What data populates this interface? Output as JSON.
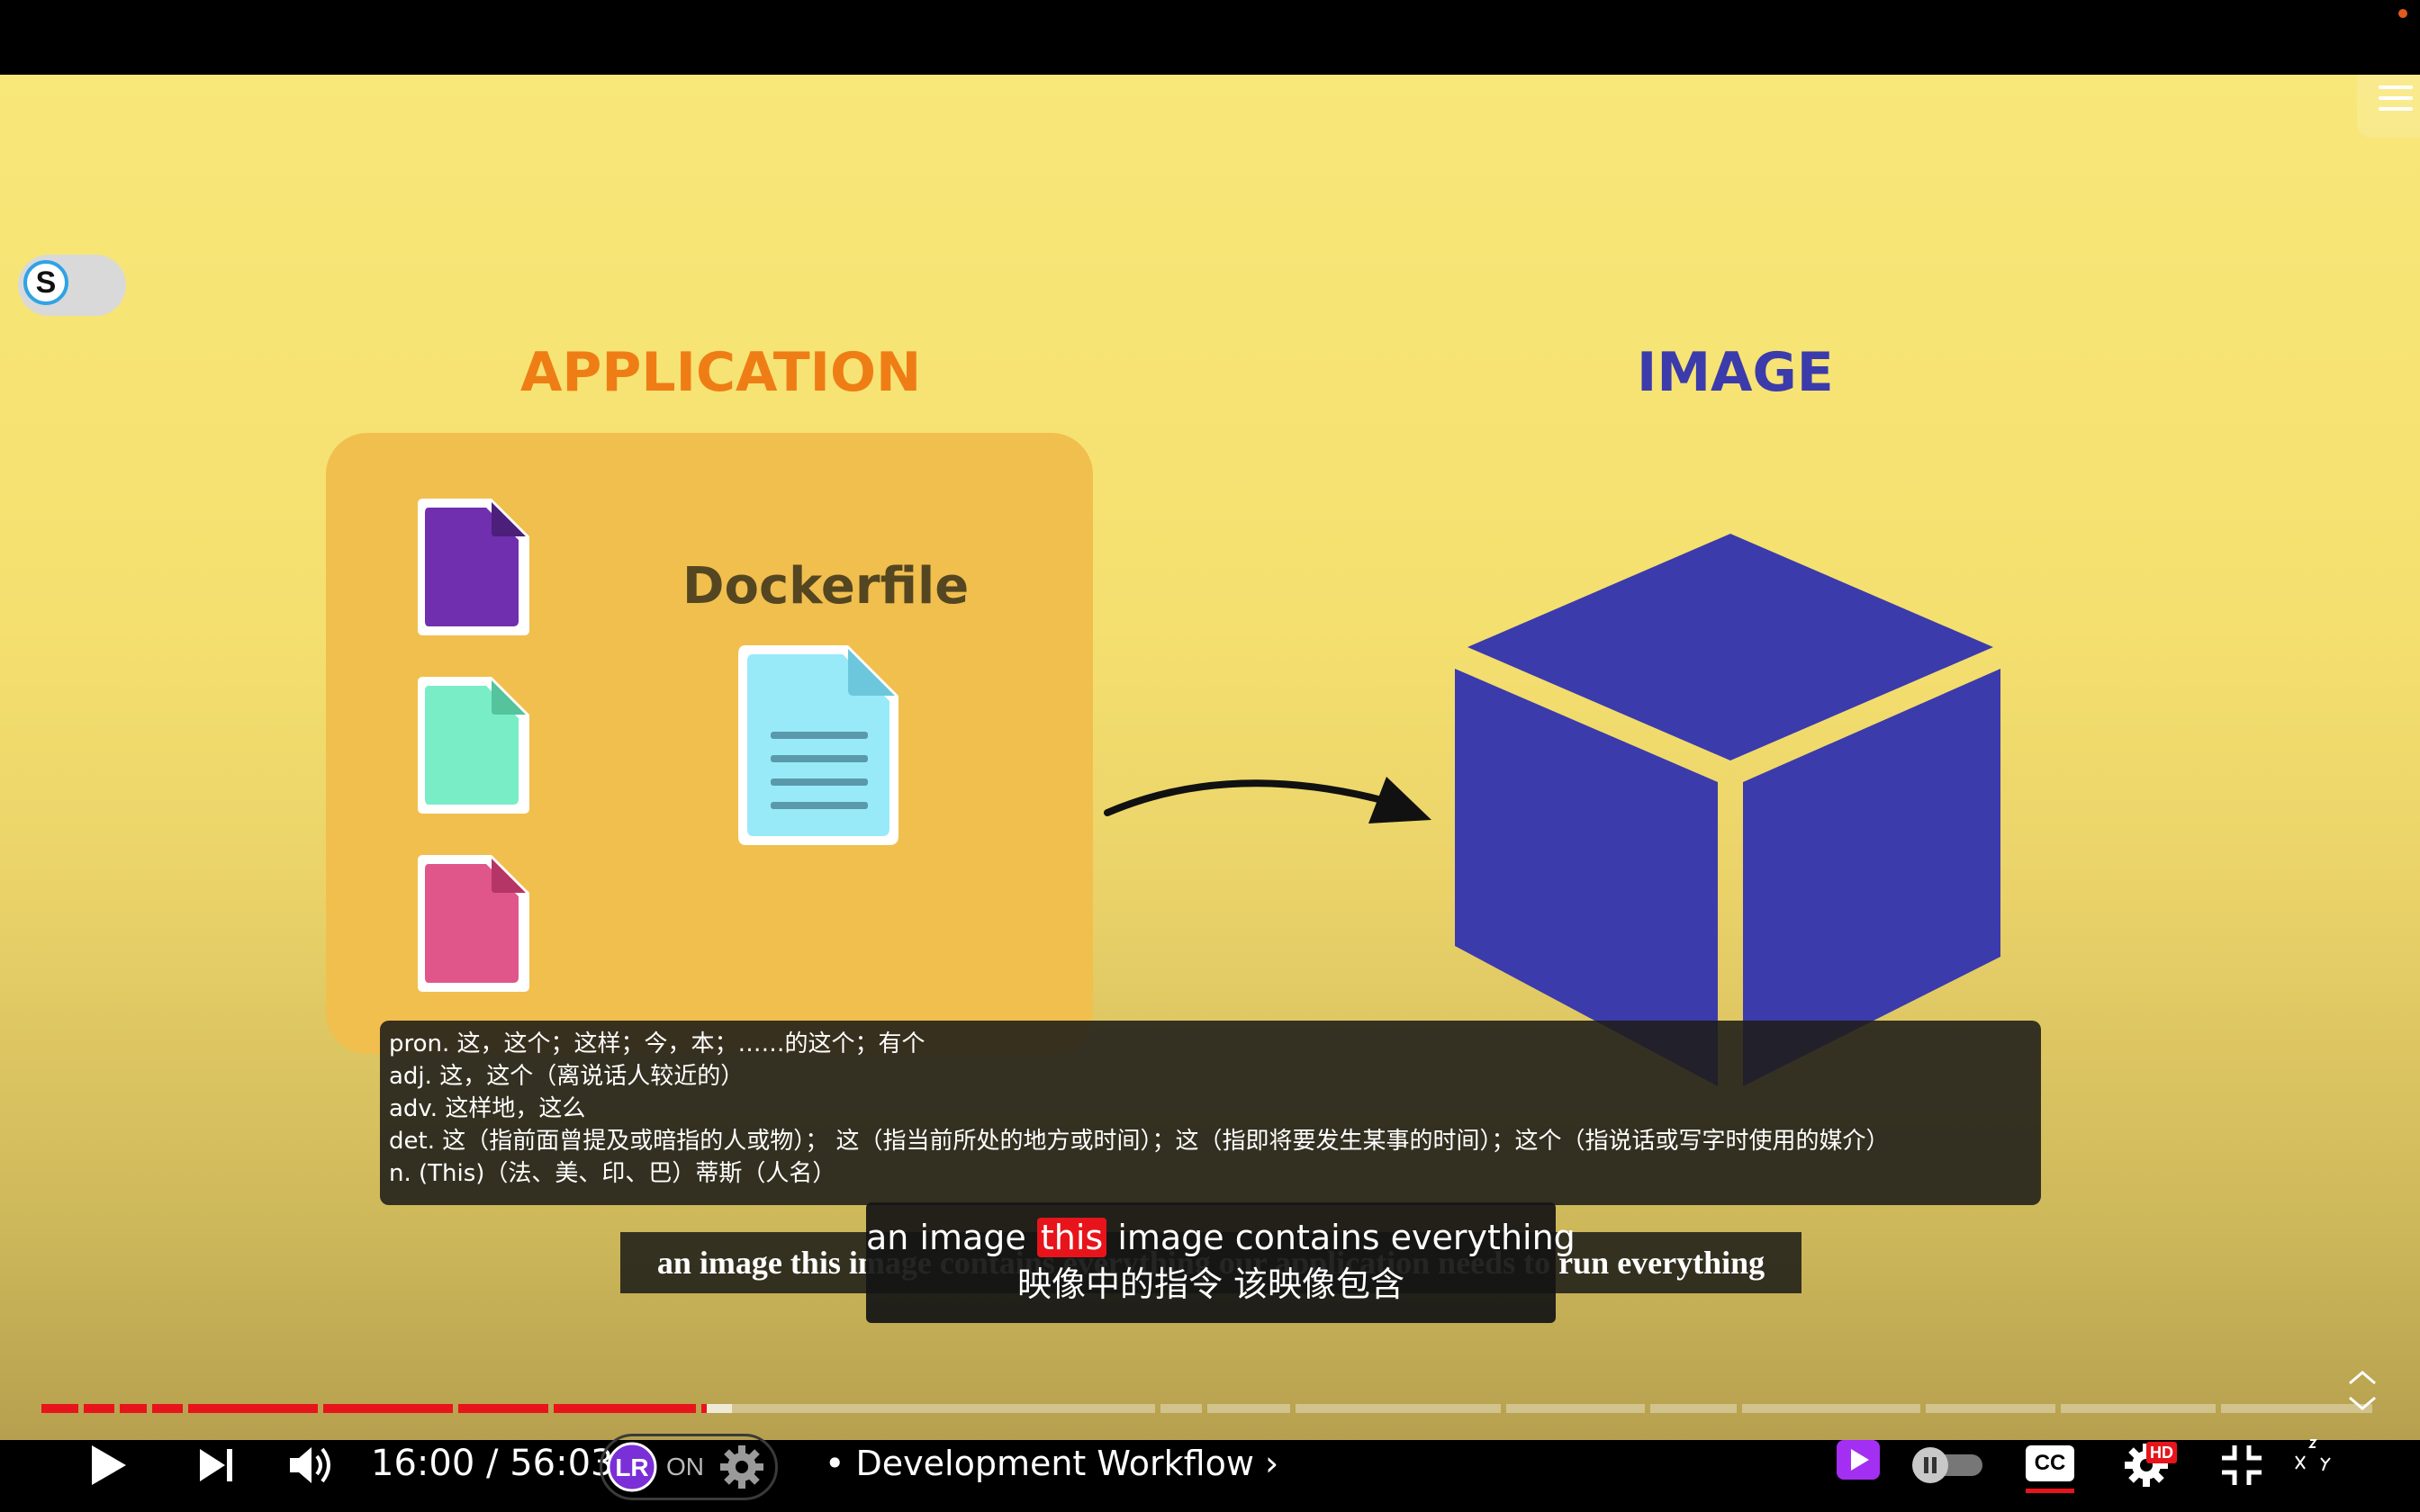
{
  "video": {
    "app_heading": "APPLICATION",
    "image_heading": "IMAGE",
    "dockerfile_label": "Dockerfile",
    "colors": {
      "app_heading": "#ef7d16",
      "image_heading": "#3c3bab",
      "cube": "#3c3bab",
      "app_box": "#f1bf4e",
      "file_purple": "#6f2fae",
      "file_green": "#79eec6",
      "file_pink": "#e0568a",
      "dockerfile": "#98eaf8"
    }
  },
  "s_toggle": {
    "letter": "S"
  },
  "dictionary": {
    "lines": [
      "pron. 这，这个；这样；今，本；……的这个；有个",
      "adj. 这，这个（离说话人较近的）",
      "adv. 这样地，这么",
      "det. 这（指前面曾提及或暗指的人或物）； 这（指当前所处的地方或时间）；这（指即将要发生某事的时间）；这个（指说话或写字时使用的媒介）",
      "n. (This)（法、美、印、巴）蒂斯（人名）"
    ]
  },
  "subtitles": {
    "original_line": "an image this image contains everything our application needs to run everything",
    "line1_before": "an image ",
    "line1_highlight": "this",
    "line1_after": " image contains everything",
    "line2": "映像中的指令 该映像包含"
  },
  "player": {
    "time_current": "16:00",
    "time_separator": " / ",
    "time_total": "56:03",
    "lr_state": "ON",
    "lr_logo": "LR",
    "chapter_prefix": "•",
    "chapter": "Development Workflow",
    "chapter_suffix": "›",
    "cc_label": "CC",
    "hd_badge": "HD",
    "progress_percent": 28.5,
    "accent_color": "#e8141b"
  }
}
